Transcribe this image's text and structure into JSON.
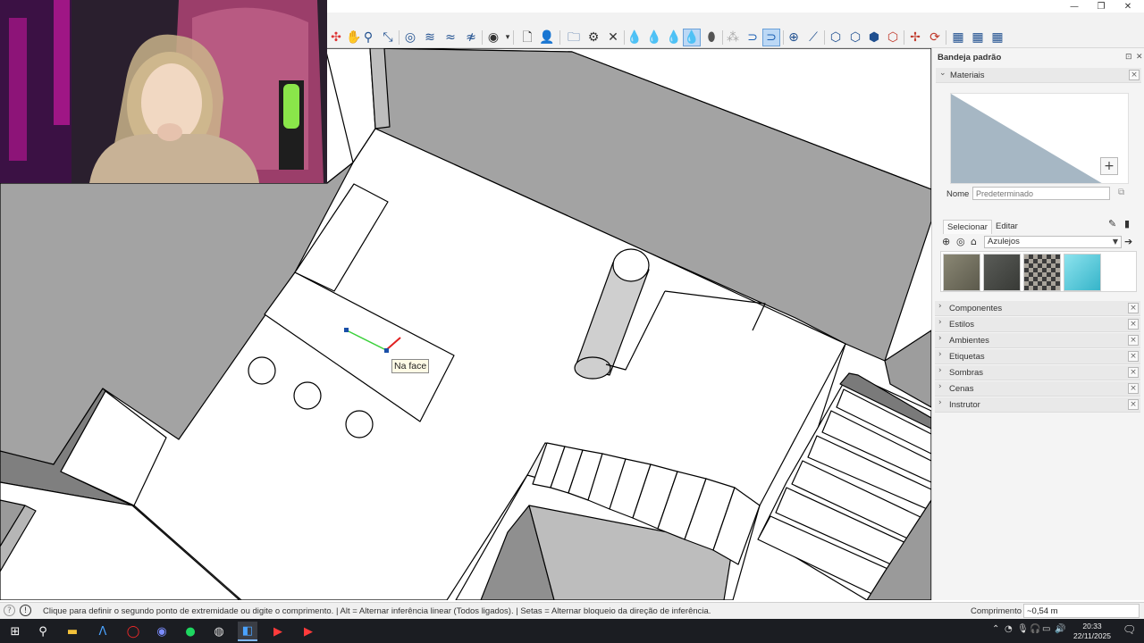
{
  "window": {
    "minimize_glyph": "—",
    "maximize_glyph": "❐",
    "close_glyph": "✕"
  },
  "viewport": {
    "tooltip": "Na face"
  },
  "tray": {
    "title": "Bandeja padrão",
    "materials": {
      "header": "Materiais",
      "name_label": "Nome",
      "name_placeholder": "Predeterminado",
      "tab_select": "Selecionar",
      "tab_edit": "Editar",
      "library": "Azulejos",
      "swatches": [
        "stone-light",
        "stone-dark",
        "checker-tile",
        "cyan-tile"
      ]
    },
    "panels": [
      "Componentes",
      "Estilos",
      "Ambientes",
      "Etiquetas",
      "Sombras",
      "Cenas",
      "Instrutor"
    ]
  },
  "statusbar": {
    "hint": "Clique para definir o segundo ponto de extremidade ou digite o comprimento. | Alt = Alternar inferência linear (Todos ligados). | Setas = Alternar bloqueio da direção de inferência.",
    "measure_label": "Comprimento",
    "measure_value": "~0,54 m"
  },
  "taskbar": {
    "time": "20:33",
    "date": "22/11/2025",
    "notifications": "8"
  },
  "colors": {
    "accent": "#2a7de1",
    "wall": "#a3a3a3",
    "wall_light": "#c9c9c9",
    "material_preview": "#a6b7c4"
  }
}
